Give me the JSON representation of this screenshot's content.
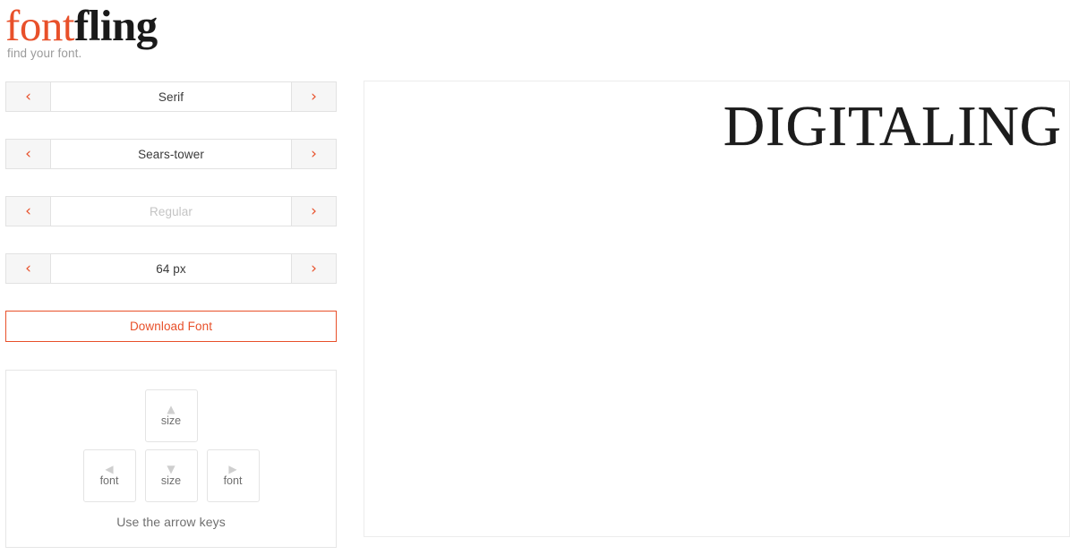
{
  "brand": {
    "name_part1": "font",
    "name_part2": "fling",
    "tagline": "find your font."
  },
  "selectors": [
    {
      "name": "category",
      "value": "Serif",
      "muted": false,
      "prev_icon": "chevron-left-icon",
      "next_icon": "chevron-right-icon",
      "prev_glyph": "‹",
      "next_glyph": "›"
    },
    {
      "name": "family",
      "value": "Sears-tower",
      "muted": false,
      "prev_icon": "chevron-left-icon",
      "next_icon": "chevron-right-icon",
      "prev_glyph": "‹",
      "next_glyph": "›"
    },
    {
      "name": "weight",
      "value": "Regular",
      "muted": true,
      "prev_icon": "chevron-left-icon",
      "next_icon": "chevron-right-icon",
      "prev_glyph": "‹",
      "next_glyph": "›"
    },
    {
      "name": "size",
      "value": "64 px",
      "muted": false,
      "prev_icon": "chevron-left-icon",
      "next_icon": "chevron-right-icon",
      "prev_glyph": "‹",
      "next_glyph": "›"
    }
  ],
  "download": {
    "label": "Download Font"
  },
  "hints": {
    "caption": "Use the arrow keys",
    "keys": {
      "up": {
        "glyph": "▲",
        "label": "size",
        "icon": "arrow-up-icon"
      },
      "left": {
        "glyph": "◀",
        "label": "font",
        "icon": "arrow-left-icon"
      },
      "down": {
        "glyph": "▼",
        "label": "size",
        "icon": "arrow-down-icon"
      },
      "right": {
        "glyph": "▶",
        "label": "font",
        "icon": "arrow-right-icon"
      }
    }
  },
  "preview": {
    "text": "DIGITALING",
    "font_size_px": "64 px"
  },
  "colors": {
    "accent": "#E8502A",
    "text_dark": "#1a1a1a",
    "text_muted": "#c4c4c4",
    "border": "#e2e2e2",
    "panel_border": "#ececec",
    "key_glyph": "#cfcfcf"
  }
}
